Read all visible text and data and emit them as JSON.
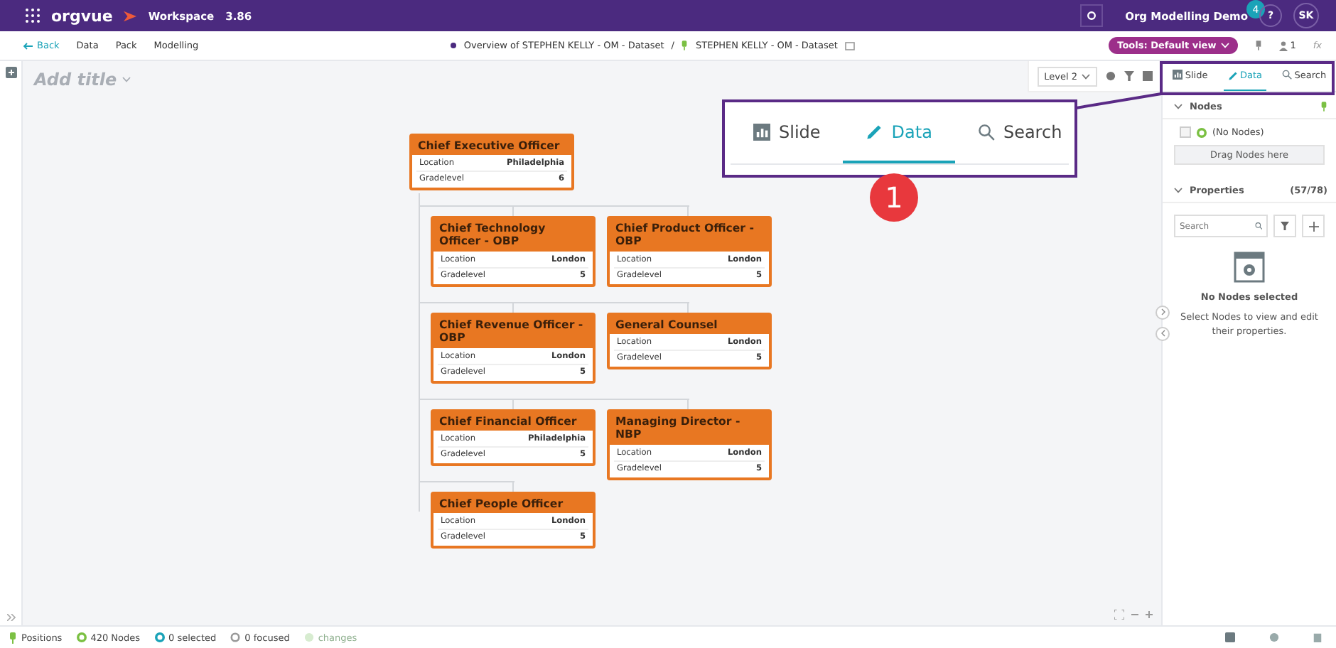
{
  "topbar": {
    "logo": "orgvue",
    "product": "Workspace",
    "version": "3.86",
    "workspace": "Org Modelling Demo",
    "notifications": "4",
    "help": "?",
    "avatar": "SK"
  },
  "navbar": {
    "back": "Back",
    "menu": [
      "Data",
      "Pack",
      "Modelling"
    ],
    "breadcrumb": {
      "overview": "Overview of STEPHEN KELLY - OM - Dataset",
      "separator": "/",
      "dataset": "STEPHEN KELLY - OM - Dataset"
    },
    "tools": "Tools: Default view",
    "users": "1",
    "formula": "fx"
  },
  "canvas": {
    "title_placeholder": "Add title",
    "level": "Level 2",
    "nodes": [
      {
        "title": "Chief Executive Officer",
        "rows": [
          {
            "label": "Location",
            "value": "Philadelphia"
          },
          {
            "label": "Gradelevel",
            "value": "6"
          }
        ]
      },
      {
        "title": "Chief Technology Officer - OBP",
        "rows": [
          {
            "label": "Location",
            "value": "London"
          },
          {
            "label": "Gradelevel",
            "value": "5"
          }
        ]
      },
      {
        "title": "Chief Product Officer - OBP",
        "rows": [
          {
            "label": "Location",
            "value": "London"
          },
          {
            "label": "Gradelevel",
            "value": "5"
          }
        ]
      },
      {
        "title": "Chief Revenue Officer - OBP",
        "rows": [
          {
            "label": "Location",
            "value": "London"
          },
          {
            "label": "Gradelevel",
            "value": "5"
          }
        ]
      },
      {
        "title": "General Counsel",
        "rows": [
          {
            "label": "Location",
            "value": "London"
          },
          {
            "label": "Gradelevel",
            "value": "5"
          }
        ]
      },
      {
        "title": "Chief Financial Officer",
        "rows": [
          {
            "label": "Location",
            "value": "Philadelphia"
          },
          {
            "label": "Gradelevel",
            "value": "5"
          }
        ]
      },
      {
        "title": "Managing Director - NBP",
        "rows": [
          {
            "label": "Location",
            "value": "London"
          },
          {
            "label": "Gradelevel",
            "value": "5"
          }
        ]
      },
      {
        "title": "Chief People Officer",
        "rows": [
          {
            "label": "Location",
            "value": "London"
          },
          {
            "label": "Gradelevel",
            "value": "5"
          }
        ]
      }
    ]
  },
  "panel": {
    "tabs": [
      {
        "label": "Slide",
        "selected": false
      },
      {
        "label": "Data",
        "selected": true
      },
      {
        "label": "Search",
        "selected": false
      }
    ],
    "nodes_section": {
      "title": "Nodes",
      "expanded": true,
      "item": {
        "label": "(No Nodes)",
        "checked": false
      },
      "drop": "Drag Nodes here"
    },
    "properties_section": {
      "title": "Properties",
      "count": "(57/78)",
      "expanded": true,
      "search_placeholder": "Search",
      "empty_title": "No Nodes selected",
      "empty_text": "Select Nodes to view and edit their properties."
    }
  },
  "callout": {
    "tabs": [
      {
        "label": "Slide",
        "selected": false
      },
      {
        "label": "Data",
        "selected": true
      },
      {
        "label": "Search",
        "selected": false
      }
    ],
    "badge": "1"
  },
  "status_bar": [
    {
      "kind": "pin",
      "label": "Positions",
      "disabled": false
    },
    {
      "kind": "nodes",
      "label": "420 Nodes",
      "disabled": false
    },
    {
      "kind": "selected",
      "label": "0 selected",
      "disabled": false
    },
    {
      "kind": "focused",
      "label": "0 focused",
      "disabled": false
    },
    {
      "kind": "changes",
      "label": "changes",
      "disabled": true
    }
  ]
}
